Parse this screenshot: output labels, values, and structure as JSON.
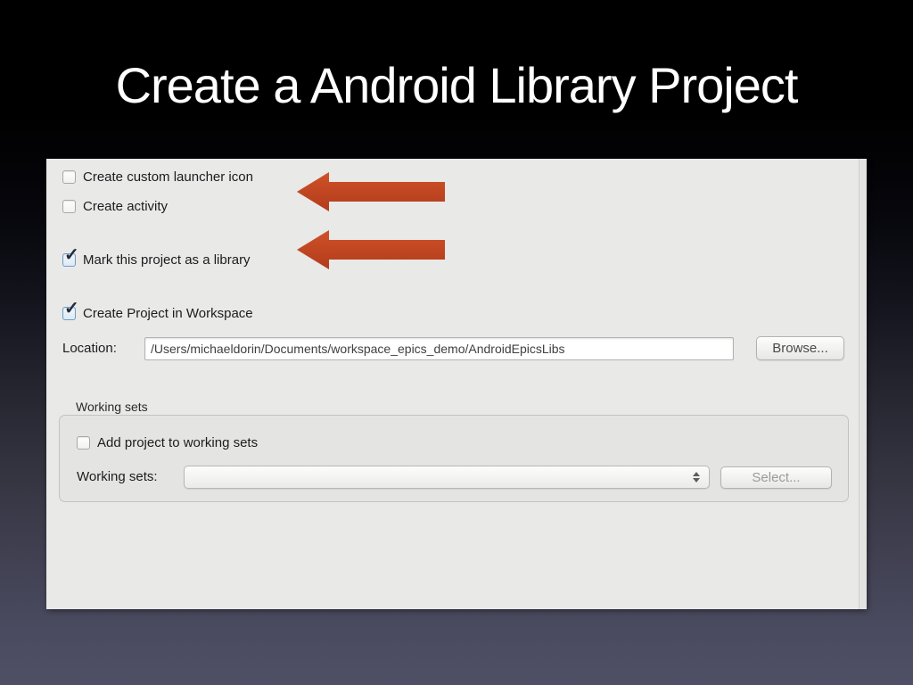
{
  "slide": {
    "title": "Create a Android Library Project"
  },
  "dialog": {
    "options": [
      {
        "label": "Create custom launcher icon",
        "checked": false
      },
      {
        "label": "Create activity",
        "checked": false
      },
      {
        "label": "Mark this project as a library",
        "checked": true
      },
      {
        "label": "Create Project in Workspace",
        "checked": true
      }
    ],
    "location": {
      "label": "Location:",
      "value": "/Users/michaeldorin/Documents/workspace_epics_demo/AndroidEpicsLibs",
      "browse_label": "Browse..."
    },
    "working_sets": {
      "group_label": "Working sets",
      "add_label": "Add project to working sets",
      "add_checked": false,
      "row_label": "Working sets:",
      "dropdown_value": "",
      "select_label": "Select...",
      "select_enabled": false
    }
  },
  "icons": {
    "checkmark": "✓"
  },
  "colors": {
    "arrow_red_top": "#cf5129",
    "arrow_red_bottom": "#b23c1b",
    "dialog_bg": "#e9e9e8",
    "title_color": "#ffffff",
    "slide_bg_bottom": "#4f4f66",
    "checked_border_blue": "#6f9dc6"
  }
}
